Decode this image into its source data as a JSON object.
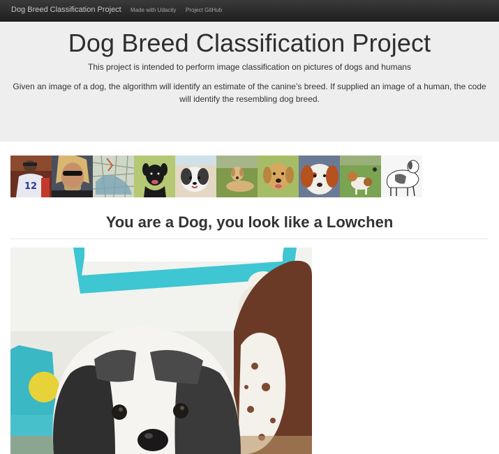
{
  "navbar": {
    "brand": "Dog Breed Classification Project",
    "links": [
      "Made with Udacity",
      "Project GitHub"
    ]
  },
  "jumbotron": {
    "title": "Dog Breed Classification Project",
    "subtitle": "This project is intended to perform image classification on pictures of dogs and humans",
    "description": "Given an image of a dog, the algorithm will identify an estimate of the canine’s breed. If supplied an image of a human, the code will identify the resembling dog breed."
  },
  "thumbnails": [
    {
      "subject": "human-photo",
      "bg": "#7a3a2a"
    },
    {
      "subject": "human-photo",
      "bg": "#6a6f7a"
    },
    {
      "subject": "map-image",
      "bg": "#c9d2c4"
    },
    {
      "subject": "dog-photo",
      "bg": "#b9c977"
    },
    {
      "subject": "dog-photo",
      "bg": "#d8c9b0"
    },
    {
      "subject": "dog-photo",
      "bg": "#7f9a4a"
    },
    {
      "subject": "dog-photo",
      "bg": "#a9bd68"
    },
    {
      "subject": "dog-photo",
      "bg": "#6a7a95"
    },
    {
      "subject": "dog-photo",
      "bg": "#7aa352"
    },
    {
      "subject": "dog-drawing",
      "bg": "#f4f4f4"
    }
  ],
  "result": {
    "heading": "You are a Dog, you look like a Lowchen"
  },
  "colors": {
    "navbar": "#222222",
    "jumbotron": "#eeeeee",
    "text": "#333333"
  }
}
